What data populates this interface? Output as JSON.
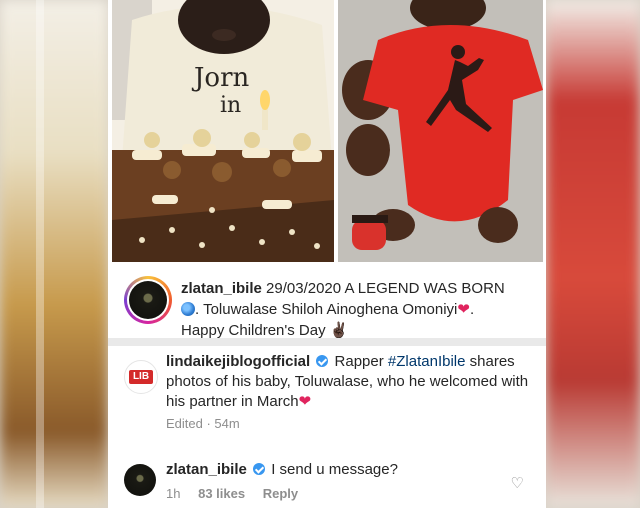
{
  "colors": {
    "ig_blue": "#3897f0",
    "heart": "#e0245e",
    "lib_red": "#d42a2a"
  },
  "photos": {
    "left": {
      "shirt_text_line1": "Jorn",
      "shirt_text_line2": "in"
    },
    "right": {
      "icon": "jumpman-logo-icon"
    }
  },
  "caption": {
    "handle": "zlatan_ibile",
    "line1": " 29/03/2020 A LEGEND WAS BORN",
    "line2": ". Toluwalase Shiloh Ainoghena Omoniyi",
    "line3": "Happy Children's Day ",
    "emoji_peace": "✌🏿",
    "emoji_heart": "❤",
    "end_dot": "."
  },
  "comment1": {
    "logo": "LIB",
    "handle": "lindaikejiblogofficial",
    "text_a": " Rapper ",
    "hashtag": "#ZlatanIbile",
    "text_b": " shares photos of his baby, Toluwalase, who he welcomed with his partner in March",
    "heart": "❤",
    "meta": "Edited · 54m"
  },
  "comment2": {
    "handle": "zlatan_ibile",
    "text": " I send u message?",
    "time": "1h",
    "likes": "83 likes",
    "reply": "Reply",
    "like_icon": "♡"
  }
}
